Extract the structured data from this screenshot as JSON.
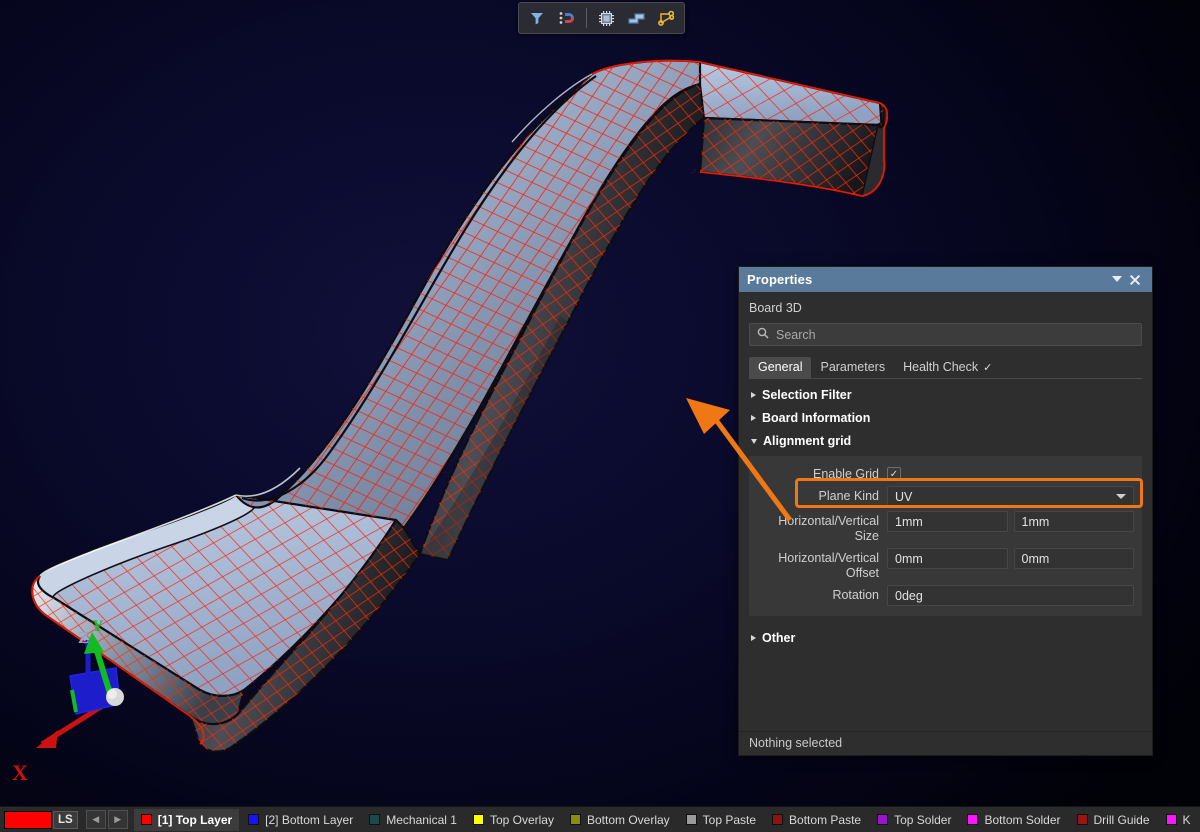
{
  "app": {
    "viewport_name": "3d-board-viewport",
    "background_color": "#0a0a2c"
  },
  "toolbar": {
    "buttons": [
      {
        "name": "filter-icon",
        "tooltip": "Filter"
      },
      {
        "name": "magnet-icon",
        "tooltip": "Snapping"
      },
      {
        "name": "component-icon",
        "tooltip": "Components"
      },
      {
        "name": "polygon-icon",
        "tooltip": "Polygons"
      },
      {
        "name": "net-route-icon",
        "tooltip": "Nets"
      }
    ]
  },
  "axis_indicator": {
    "x_label": "X",
    "y_label": "Y",
    "z_label": "Z",
    "x_color": "#cc1111",
    "y_color": "#11bb22",
    "z_color": "#2233dd"
  },
  "properties": {
    "title": "Properties",
    "collapse_icon": "chevron-down-icon",
    "close_icon": "close-icon",
    "subtitle": "Board 3D",
    "search": {
      "placeholder": "Search",
      "value": "",
      "icon": "search-icon"
    },
    "tabs": [
      {
        "label": "General",
        "active": true,
        "check": ""
      },
      {
        "label": "Parameters",
        "active": false,
        "check": ""
      },
      {
        "label": "Health Check",
        "active": false,
        "check": "✓"
      }
    ],
    "sections": [
      {
        "label": "Selection Filter",
        "expanded": false
      },
      {
        "label": "Board Information",
        "expanded": false
      },
      {
        "label": "Alignment grid",
        "expanded": true
      },
      {
        "label": "Other",
        "expanded": false
      }
    ],
    "alignment_grid": {
      "enable_grid": {
        "label": "Enable Grid",
        "checked": true,
        "check_glyph": "✓"
      },
      "plane_kind": {
        "label": "Plane Kind",
        "value": "UV",
        "highlighted": true
      },
      "hv_size": {
        "label": "Horizontal/Vertical Size",
        "h": "1mm",
        "v": "1mm"
      },
      "hv_offset": {
        "label": "Horizontal/Vertical Offset",
        "h": "0mm",
        "v": "0mm"
      },
      "rotation": {
        "label": "Rotation",
        "value": "0deg"
      }
    },
    "status": "Nothing selected",
    "highlight_color": "#f07814"
  },
  "layerbar": {
    "ls_label": "LS",
    "ls_swatch_color": "#ff0000",
    "prev_icon": "◀",
    "next_icon": "▶",
    "layers": [
      {
        "name": "[1] Top Layer",
        "color": "#ff0000",
        "active": true
      },
      {
        "name": "[2] Bottom Layer",
        "color": "#1414ff",
        "active": false
      },
      {
        "name": "Mechanical 1",
        "color": "#1a4a4a",
        "active": false
      },
      {
        "name": "Top Overlay",
        "color": "#ffff00",
        "active": false
      },
      {
        "name": "Bottom Overlay",
        "color": "#8a8a14",
        "active": false
      },
      {
        "name": "Top Paste",
        "color": "#9a9a9a",
        "active": false
      },
      {
        "name": "Bottom Paste",
        "color": "#8a1414",
        "active": false
      },
      {
        "name": "Top Solder",
        "color": "#9a14c8",
        "active": false
      },
      {
        "name": "Bottom Solder",
        "color": "#ff14ff",
        "active": false
      },
      {
        "name": "Drill Guide",
        "color": "#9a1414",
        "active": false
      },
      {
        "name": "K",
        "color": "#ff14ff",
        "active": false
      }
    ]
  }
}
